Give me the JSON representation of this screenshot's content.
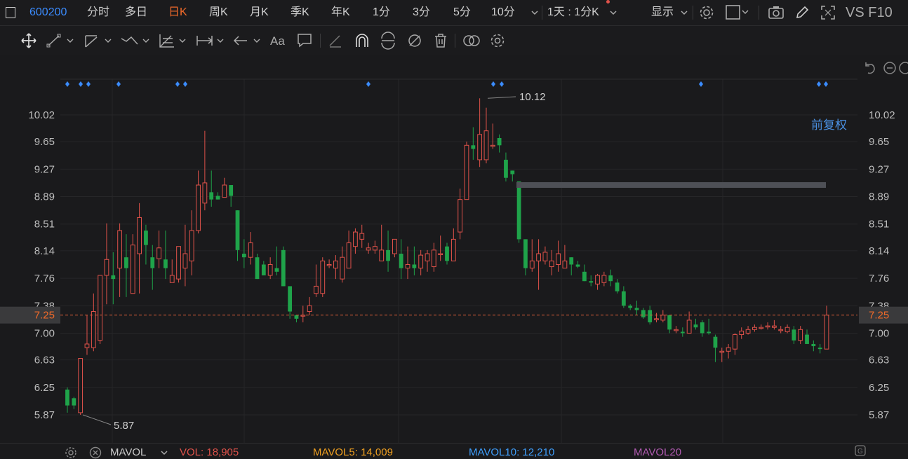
{
  "header": {
    "code": "600200",
    "periods": [
      "分时",
      "多日",
      "日K",
      "周K",
      "月K",
      "季K",
      "年K",
      "1分",
      "3分",
      "5分",
      "10分"
    ],
    "active_period": "日K",
    "multi_period": "1天 : 1分K",
    "display": "显示",
    "vs_f10": "VS F10"
  },
  "chart": {
    "fq_label": "前复权",
    "price_ticks": [
      "10.02",
      "9.65",
      "9.27",
      "8.89",
      "8.51",
      "8.14",
      "7.76",
      "7.38",
      "7.00",
      "6.63",
      "6.25",
      "5.87"
    ],
    "current_price": "7.25",
    "high_label": "10.12",
    "low_label": "5.87"
  },
  "chart_data": {
    "type": "candlestick",
    "ylim": [
      5.7,
      10.35
    ],
    "candles": [
      [
        6.22,
        6.0,
        6.25,
        5.9
      ],
      [
        6.1,
        6.0,
        6.12,
        5.95
      ],
      [
        5.9,
        6.65,
        6.65,
        5.87
      ],
      [
        6.8,
        6.85,
        7.25,
        6.7
      ],
      [
        6.8,
        7.3,
        7.55,
        6.75
      ],
      [
        6.9,
        7.8,
        7.8,
        6.85
      ],
      [
        7.8,
        8.02,
        8.52,
        7.4
      ],
      [
        7.8,
        7.75,
        8.12,
        7.4
      ],
      [
        7.9,
        8.42,
        8.52,
        7.5
      ],
      [
        8.05,
        7.9,
        8.37,
        7.5
      ],
      [
        7.55,
        8.22,
        8.37,
        7.55
      ],
      [
        8.1,
        8.6,
        8.8,
        7.55
      ],
      [
        8.42,
        8.22,
        8.5,
        7.95
      ],
      [
        8.05,
        7.9,
        8.22,
        7.6
      ],
      [
        8.03,
        8.18,
        8.42,
        7.9
      ],
      [
        8.02,
        7.9,
        8.42,
        7.75
      ],
      [
        7.7,
        7.8,
        8.02,
        7.7
      ],
      [
        7.75,
        8.2,
        8.2,
        7.7
      ],
      [
        7.9,
        8.1,
        8.5,
        7.65
      ],
      [
        8.0,
        8.42,
        8.7,
        7.8
      ],
      [
        8.42,
        9.05,
        9.25,
        8.38
      ],
      [
        8.8,
        9.08,
        9.8,
        8.7
      ],
      [
        8.95,
        8.85,
        9.25,
        8.75
      ],
      [
        8.9,
        8.85,
        8.95,
        8.85
      ],
      [
        8.88,
        9.05,
        9.15,
        8.88
      ],
      [
        9.05,
        8.9,
        9.05,
        8.75
      ],
      [
        8.7,
        8.15,
        8.7,
        8.0
      ],
      [
        8.1,
        8.05,
        8.3,
        7.9
      ],
      [
        8.05,
        8.25,
        8.4,
        7.95
      ],
      [
        8.05,
        7.75,
        8.1,
        7.75
      ],
      [
        7.95,
        7.8,
        8.0,
        7.8
      ],
      [
        7.8,
        7.95,
        8.05,
        7.75
      ],
      [
        7.9,
        7.85,
        8.2,
        7.8
      ],
      [
        8.15,
        7.65,
        8.2,
        7.65
      ],
      [
        7.65,
        7.3,
        7.65,
        7.2
      ],
      [
        7.25,
        7.2,
        7.25,
        7.15
      ],
      [
        7.25,
        7.25,
        7.38,
        7.15
      ],
      [
        7.3,
        7.38,
        7.5,
        7.25
      ],
      [
        7.55,
        7.65,
        7.95,
        7.5
      ],
      [
        7.55,
        8.0,
        8.05,
        7.5
      ],
      [
        7.95,
        7.95,
        8.02,
        7.9
      ],
      [
        7.9,
        8.0,
        8.08,
        7.75
      ],
      [
        7.75,
        8.05,
        8.2,
        7.7
      ],
      [
        7.9,
        8.25,
        8.42,
        7.9
      ],
      [
        8.2,
        8.4,
        8.45,
        8.1
      ],
      [
        8.3,
        8.38,
        8.5,
        8.18
      ],
      [
        8.15,
        8.18,
        8.25,
        8.1
      ],
      [
        8.15,
        8.2,
        8.28,
        8.1
      ],
      [
        8.0,
        8.15,
        8.5,
        8.0
      ],
      [
        8.15,
        8.0,
        8.42,
        7.85
      ],
      [
        8.1,
        8.3,
        8.3,
        8.05
      ],
      [
        8.1,
        7.9,
        8.3,
        7.75
      ],
      [
        7.9,
        7.95,
        8.2,
        7.75
      ],
      [
        7.95,
        7.9,
        8.2,
        7.8
      ],
      [
        7.9,
        8.08,
        8.15,
        7.8
      ],
      [
        8.0,
        8.1,
        8.15,
        7.85
      ],
      [
        7.92,
        8.15,
        8.25,
        7.85
      ],
      [
        8.1,
        8.1,
        8.35,
        8.0
      ],
      [
        8.2,
        8.0,
        8.25,
        7.95
      ],
      [
        8.0,
        8.3,
        8.45,
        8.0
      ],
      [
        8.4,
        8.85,
        9.0,
        8.3
      ],
      [
        8.85,
        9.6,
        9.65,
        8.85
      ],
      [
        9.6,
        9.55,
        9.85,
        9.4
      ],
      [
        9.4,
        9.75,
        10.25,
        9.3
      ],
      [
        9.4,
        9.8,
        10.12,
        9.35
      ],
      [
        9.6,
        9.6,
        9.9,
        9.55
      ],
      [
        9.7,
        9.6,
        9.75,
        9.5
      ],
      [
        9.4,
        9.15,
        9.5,
        9.1
      ],
      [
        9.25,
        9.2,
        9.25,
        9.1
      ],
      [
        9.1,
        8.3,
        9.1,
        8.25
      ],
      [
        8.3,
        7.9,
        8.3,
        7.8
      ],
      [
        7.9,
        8.0,
        8.3,
        7.85
      ],
      [
        8.0,
        8.1,
        8.3,
        7.6
      ],
      [
        8.0,
        8.12,
        8.2,
        7.95
      ],
      [
        7.92,
        8.0,
        8.15,
        7.8
      ],
      [
        7.95,
        8.1,
        8.28,
        7.85
      ],
      [
        7.9,
        8.0,
        8.22,
        7.95
      ],
      [
        8.05,
        7.95,
        8.05,
        7.8
      ],
      [
        7.95,
        7.92,
        8.0,
        7.9
      ],
      [
        7.85,
        7.72,
        7.95,
        7.72
      ],
      [
        7.72,
        7.7,
        7.8,
        7.65
      ],
      [
        7.68,
        7.8,
        7.82,
        7.6
      ],
      [
        7.7,
        7.8,
        7.85,
        7.65
      ],
      [
        7.8,
        7.72,
        7.88,
        7.65
      ],
      [
        7.7,
        7.58,
        7.75,
        7.55
      ],
      [
        7.58,
        7.38,
        7.65,
        7.35
      ],
      [
        7.38,
        7.35,
        7.4,
        7.32
      ],
      [
        7.35,
        7.32,
        7.45,
        7.25
      ],
      [
        7.32,
        7.22,
        7.35,
        7.2
      ],
      [
        7.32,
        7.15,
        7.38,
        7.12
      ],
      [
        7.2,
        7.2,
        7.28,
        7.15
      ],
      [
        7.18,
        7.25,
        7.32,
        7.15
      ],
      [
        7.25,
        7.05,
        7.25,
        7.0
      ],
      [
        7.05,
        7.05,
        7.1,
        7.0
      ],
      [
        7.02,
        7.0,
        7.08,
        6.95
      ],
      [
        7.0,
        7.18,
        7.3,
        7.0
      ],
      [
        7.12,
        7.08,
        7.2,
        7.05
      ],
      [
        7.15,
        7.0,
        7.18,
        6.95
      ],
      [
        7.02,
        7.0,
        7.2,
        6.98
      ],
      [
        6.95,
        6.8,
        6.98,
        6.6
      ],
      [
        6.75,
        6.75,
        6.8,
        6.6
      ],
      [
        6.75,
        6.8,
        6.85,
        6.65
      ],
      [
        6.78,
        6.98,
        7.0,
        6.7
      ],
      [
        6.98,
        7.03,
        7.08,
        6.92
      ],
      [
        7.0,
        7.05,
        7.1,
        6.98
      ],
      [
        7.05,
        7.08,
        7.12,
        7.02
      ],
      [
        7.08,
        7.08,
        7.12,
        7.05
      ],
      [
        7.1,
        7.1,
        7.15,
        7.05
      ],
      [
        7.08,
        7.1,
        7.18,
        7.05
      ],
      [
        7.05,
        7.05,
        7.1,
        7.0
      ],
      [
        7.02,
        7.08,
        7.12,
        7.0
      ],
      [
        7.05,
        6.9,
        7.1,
        6.85
      ],
      [
        6.9,
        7.05,
        7.1,
        6.85
      ],
      [
        6.98,
        6.85,
        7.05,
        6.85
      ],
      [
        6.85,
        6.82,
        6.9,
        6.75
      ],
      [
        6.8,
        6.78,
        6.85,
        6.72
      ],
      [
        6.78,
        7.25,
        7.38,
        6.78
      ]
    ],
    "event_markers": [
      96,
      115,
      126,
      169,
      253,
      264,
      525,
      703,
      715,
      999,
      1167,
      1177
    ]
  },
  "indicators": {
    "mavol_name": "MAVOL",
    "vol": "VOL: 18,905",
    "mavol5": "MAVOL5: 14,009",
    "mavol10": "MAVOL10: 12,210",
    "mavol20": "MAVOL20"
  },
  "colors": {
    "up": "#e0524a",
    "down": "#1fa34a",
    "accent": "#f06a2a",
    "link": "#3b8cff"
  }
}
